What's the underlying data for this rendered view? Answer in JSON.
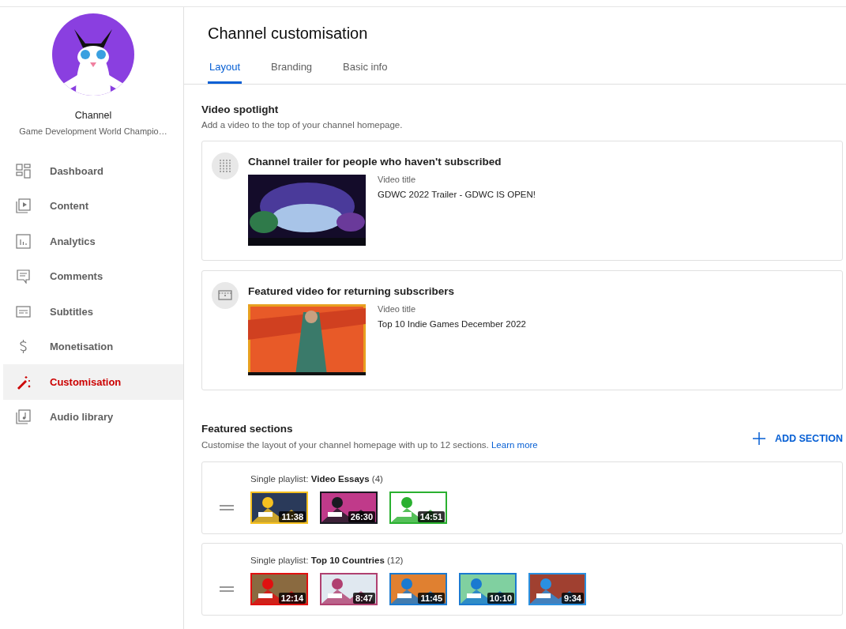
{
  "sidebar": {
    "channel_label": "Channel",
    "channel_name": "Game Development World Champio…",
    "items": [
      {
        "label": "Dashboard",
        "selected": false
      },
      {
        "label": "Content",
        "selected": false
      },
      {
        "label": "Analytics",
        "selected": false
      },
      {
        "label": "Comments",
        "selected": false
      },
      {
        "label": "Subtitles",
        "selected": false
      },
      {
        "label": "Monetisation",
        "selected": false
      },
      {
        "label": "Customisation",
        "selected": true
      },
      {
        "label": "Audio library",
        "selected": false
      }
    ]
  },
  "page_title": "Channel customisation",
  "tabs": [
    {
      "label": "Layout",
      "selected": true
    },
    {
      "label": "Branding",
      "selected": false
    },
    {
      "label": "Basic info",
      "selected": false
    }
  ],
  "video_spotlight": {
    "heading": "Video spotlight",
    "description": "Add a video to the top of your channel homepage.",
    "cards": [
      {
        "title": "Channel trailer for people who haven't subscribed",
        "video_label": "Video title",
        "video_title": "GDWC 2022 Trailer - GDWC IS OPEN!"
      },
      {
        "title": "Featured video for returning subscribers",
        "video_label": "Video title",
        "video_title": "Top 10 Indie Games December 2022"
      }
    ]
  },
  "featured_sections": {
    "heading": "Featured sections",
    "description": "Customise the layout of your channel homepage with up to 12 sections.",
    "link": "Learn more",
    "add_button": "ADD SECTION",
    "sections": [
      {
        "label": "Single playlist: **Video Essays** (4)",
        "thumbnails": [
          {
            "kind": "picture",
            "duration": "11:38"
          },
          {
            "kind": "picture",
            "duration": "26:30"
          },
          {
            "kind": "picture",
            "duration": "14:51"
          }
        ]
      },
      {
        "label": "Single playlist: **Top 10 Countries** (12)",
        "thumbnails": [
          {
            "kind": "picture",
            "duration": "12:14"
          },
          {
            "kind": "picture",
            "duration": "8:47"
          },
          {
            "kind": "picture",
            "duration": "11:45"
          },
          {
            "kind": "picture",
            "duration": "10:10"
          },
          {
            "kind": "picture",
            "duration": "9:34"
          }
        ]
      }
    ]
  }
}
